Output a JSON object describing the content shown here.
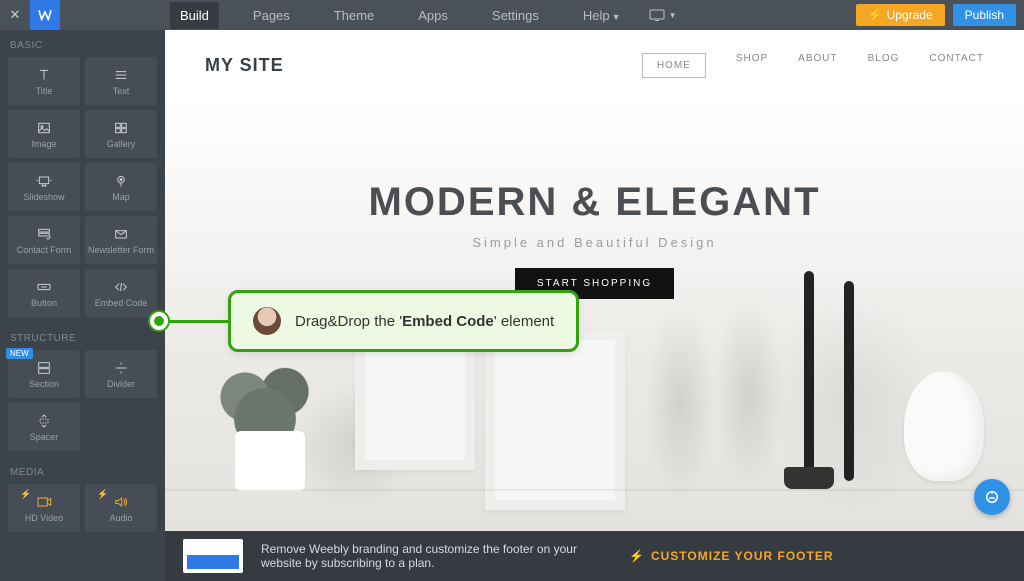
{
  "topbar": {
    "tabs": [
      "Build",
      "Pages",
      "Theme",
      "Apps",
      "Settings",
      "Help"
    ],
    "upgrade": "Upgrade",
    "publish": "Publish"
  },
  "panel": {
    "basic_title": "BASIC",
    "structure_title": "STRUCTURE",
    "media_title": "MEDIA",
    "basic": [
      {
        "label": "Title"
      },
      {
        "label": "Text"
      },
      {
        "label": "Image"
      },
      {
        "label": "Gallery"
      },
      {
        "label": "Slideshow"
      },
      {
        "label": "Map"
      },
      {
        "label": "Contact Form"
      },
      {
        "label": "Newsletter Form"
      },
      {
        "label": "Button"
      },
      {
        "label": "Embed Code"
      }
    ],
    "structure": [
      {
        "label": "Section"
      },
      {
        "label": "Divider"
      },
      {
        "label": "Spacer"
      }
    ],
    "media": [
      {
        "label": "HD Video"
      },
      {
        "label": "Audio"
      }
    ],
    "new_badge": "NEW"
  },
  "site": {
    "title": "MY SITE",
    "nav": [
      "HOME",
      "SHOP",
      "ABOUT",
      "BLOG",
      "CONTACT"
    ],
    "hero_title": "MODERN & ELEGANT",
    "hero_sub": "Simple and Beautiful Design",
    "hero_cta": "START SHOPPING"
  },
  "callout": {
    "prefix": "Drag&Drop the '",
    "bold": "Embed Code",
    "suffix": "' element"
  },
  "footer": {
    "msg": "Remove Weebly branding and customize the footer on your website by subscribing to a plan.",
    "cta": "CUSTOMIZE YOUR FOOTER"
  }
}
